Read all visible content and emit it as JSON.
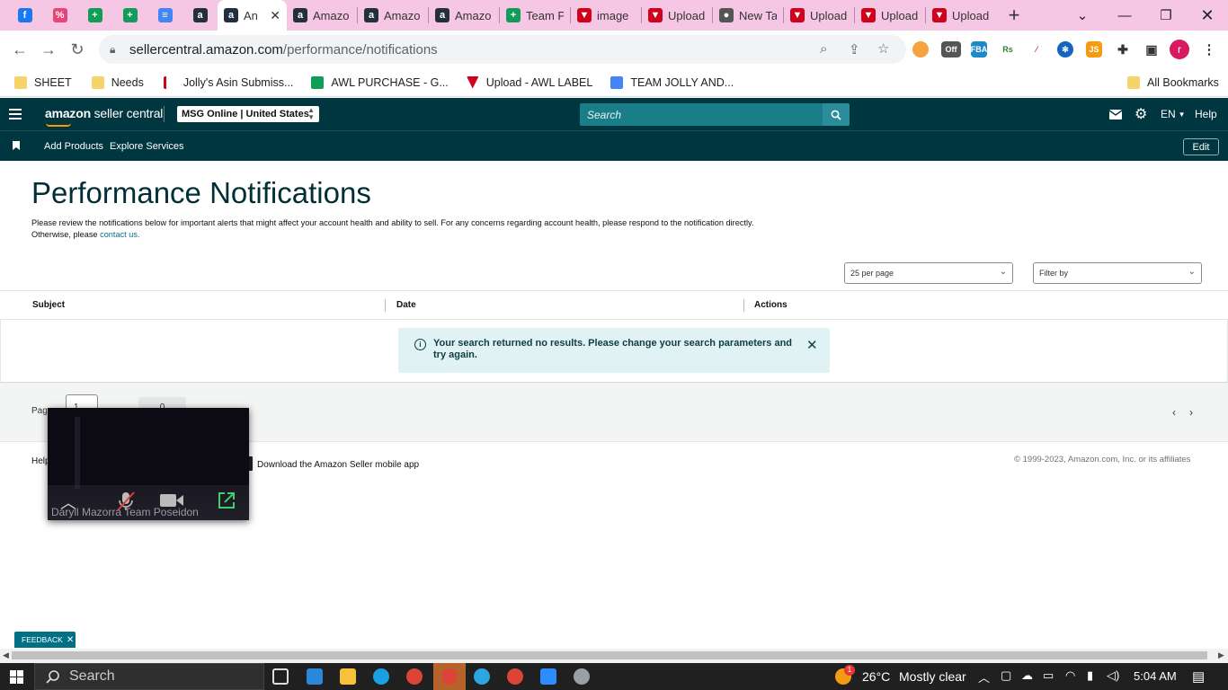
{
  "browser": {
    "tabs": [
      {
        "title": "",
        "icon": "facebook-icon",
        "color": "#1877f2"
      },
      {
        "title": "",
        "icon": "percent-icon",
        "color": "#e8437a"
      },
      {
        "title": "",
        "icon": "sheets-icon",
        "color": "#0f9d58"
      },
      {
        "title": "",
        "icon": "sheets-icon",
        "color": "#0f9d58"
      },
      {
        "title": "",
        "icon": "docs-icon",
        "color": "#4285f4"
      },
      {
        "title": "",
        "icon": "amazon-icon",
        "color": "#232f3e"
      },
      {
        "title": "An",
        "icon": "amazon-icon",
        "color": "#232f3e",
        "active": true
      },
      {
        "title": "Amazo",
        "icon": "amazon-icon",
        "color": "#232f3e"
      },
      {
        "title": "Amazo",
        "icon": "amazon-icon",
        "color": "#232f3e"
      },
      {
        "title": "Amazo",
        "icon": "amazon-icon",
        "color": "#232f3e"
      },
      {
        "title": "Team P",
        "icon": "sheets-icon",
        "color": "#0f9d58"
      },
      {
        "title": "image",
        "icon": "upload-label-icon",
        "color": "#d0021b"
      },
      {
        "title": "Upload",
        "icon": "upload-label-icon",
        "color": "#d0021b"
      },
      {
        "title": "New Ta",
        "icon": "chrome-icon",
        "color": "#555555"
      },
      {
        "title": "Upload",
        "icon": "upload-label-icon",
        "color": "#d0021b"
      },
      {
        "title": "Upload",
        "icon": "upload-label-icon",
        "color": "#d0021b"
      },
      {
        "title": "Upload",
        "icon": "upload-label-icon",
        "color": "#d0021b"
      }
    ],
    "url_host": "sellercentral.amazon.com",
    "url_path": "/performance/notifications",
    "profile_initial": "r",
    "bookmarks": [
      {
        "label": "SHEET",
        "icon": "folder-icon"
      },
      {
        "label": "Needs",
        "icon": "folder-icon"
      },
      {
        "label": "Jolly's Asin Submiss...",
        "icon": "bookmark-icon"
      },
      {
        "label": "AWL PURCHASE - G...",
        "icon": "sheets-icon"
      },
      {
        "label": "Upload - AWL LABEL",
        "icon": "upload-label-icon"
      },
      {
        "label": "TEAM JOLLY AND...",
        "icon": "docs-icon"
      }
    ],
    "all_bookmarks": "All Bookmarks"
  },
  "header": {
    "logo_bold": "amazon",
    "logo_rest": " seller central",
    "store": "MSG Online | United States",
    "search_placeholder": "Search",
    "language": "EN",
    "help": "Help",
    "nav_links": [
      "Add Products",
      "Explore Services"
    ],
    "edit": "Edit"
  },
  "main": {
    "title": "Performance Notifications",
    "description_1": "Please review the notifications below for important alerts that might affect your account health and ability to sell. For any concerns regarding account health, please respond to the notification directly.",
    "description_2": "Otherwise, please ",
    "contact_link": "contact us.",
    "per_page": "25 per page",
    "filter_by": "Filter by",
    "columns": [
      "Subject",
      "Date",
      "Actions"
    ],
    "alert_message": "Your search returned no results. Please change your search parameters and try again.",
    "page_label": "Pag",
    "page_value": "1",
    "page_button": "0"
  },
  "footer": {
    "help": "Help",
    "app_link": "Download the Amazon Seller mobile app",
    "copyright": "© 1999-2023, Amazon.com, Inc. or its affiliates"
  },
  "video_overlay": {
    "caption": "Daryll Mazorra Team Poseidon"
  },
  "feedback": "FEEDBACK",
  "taskbar": {
    "search": "Search",
    "temperature": "26°C",
    "weather": "Mostly clear",
    "time": "5:04 AM",
    "weather_badge": "1"
  }
}
